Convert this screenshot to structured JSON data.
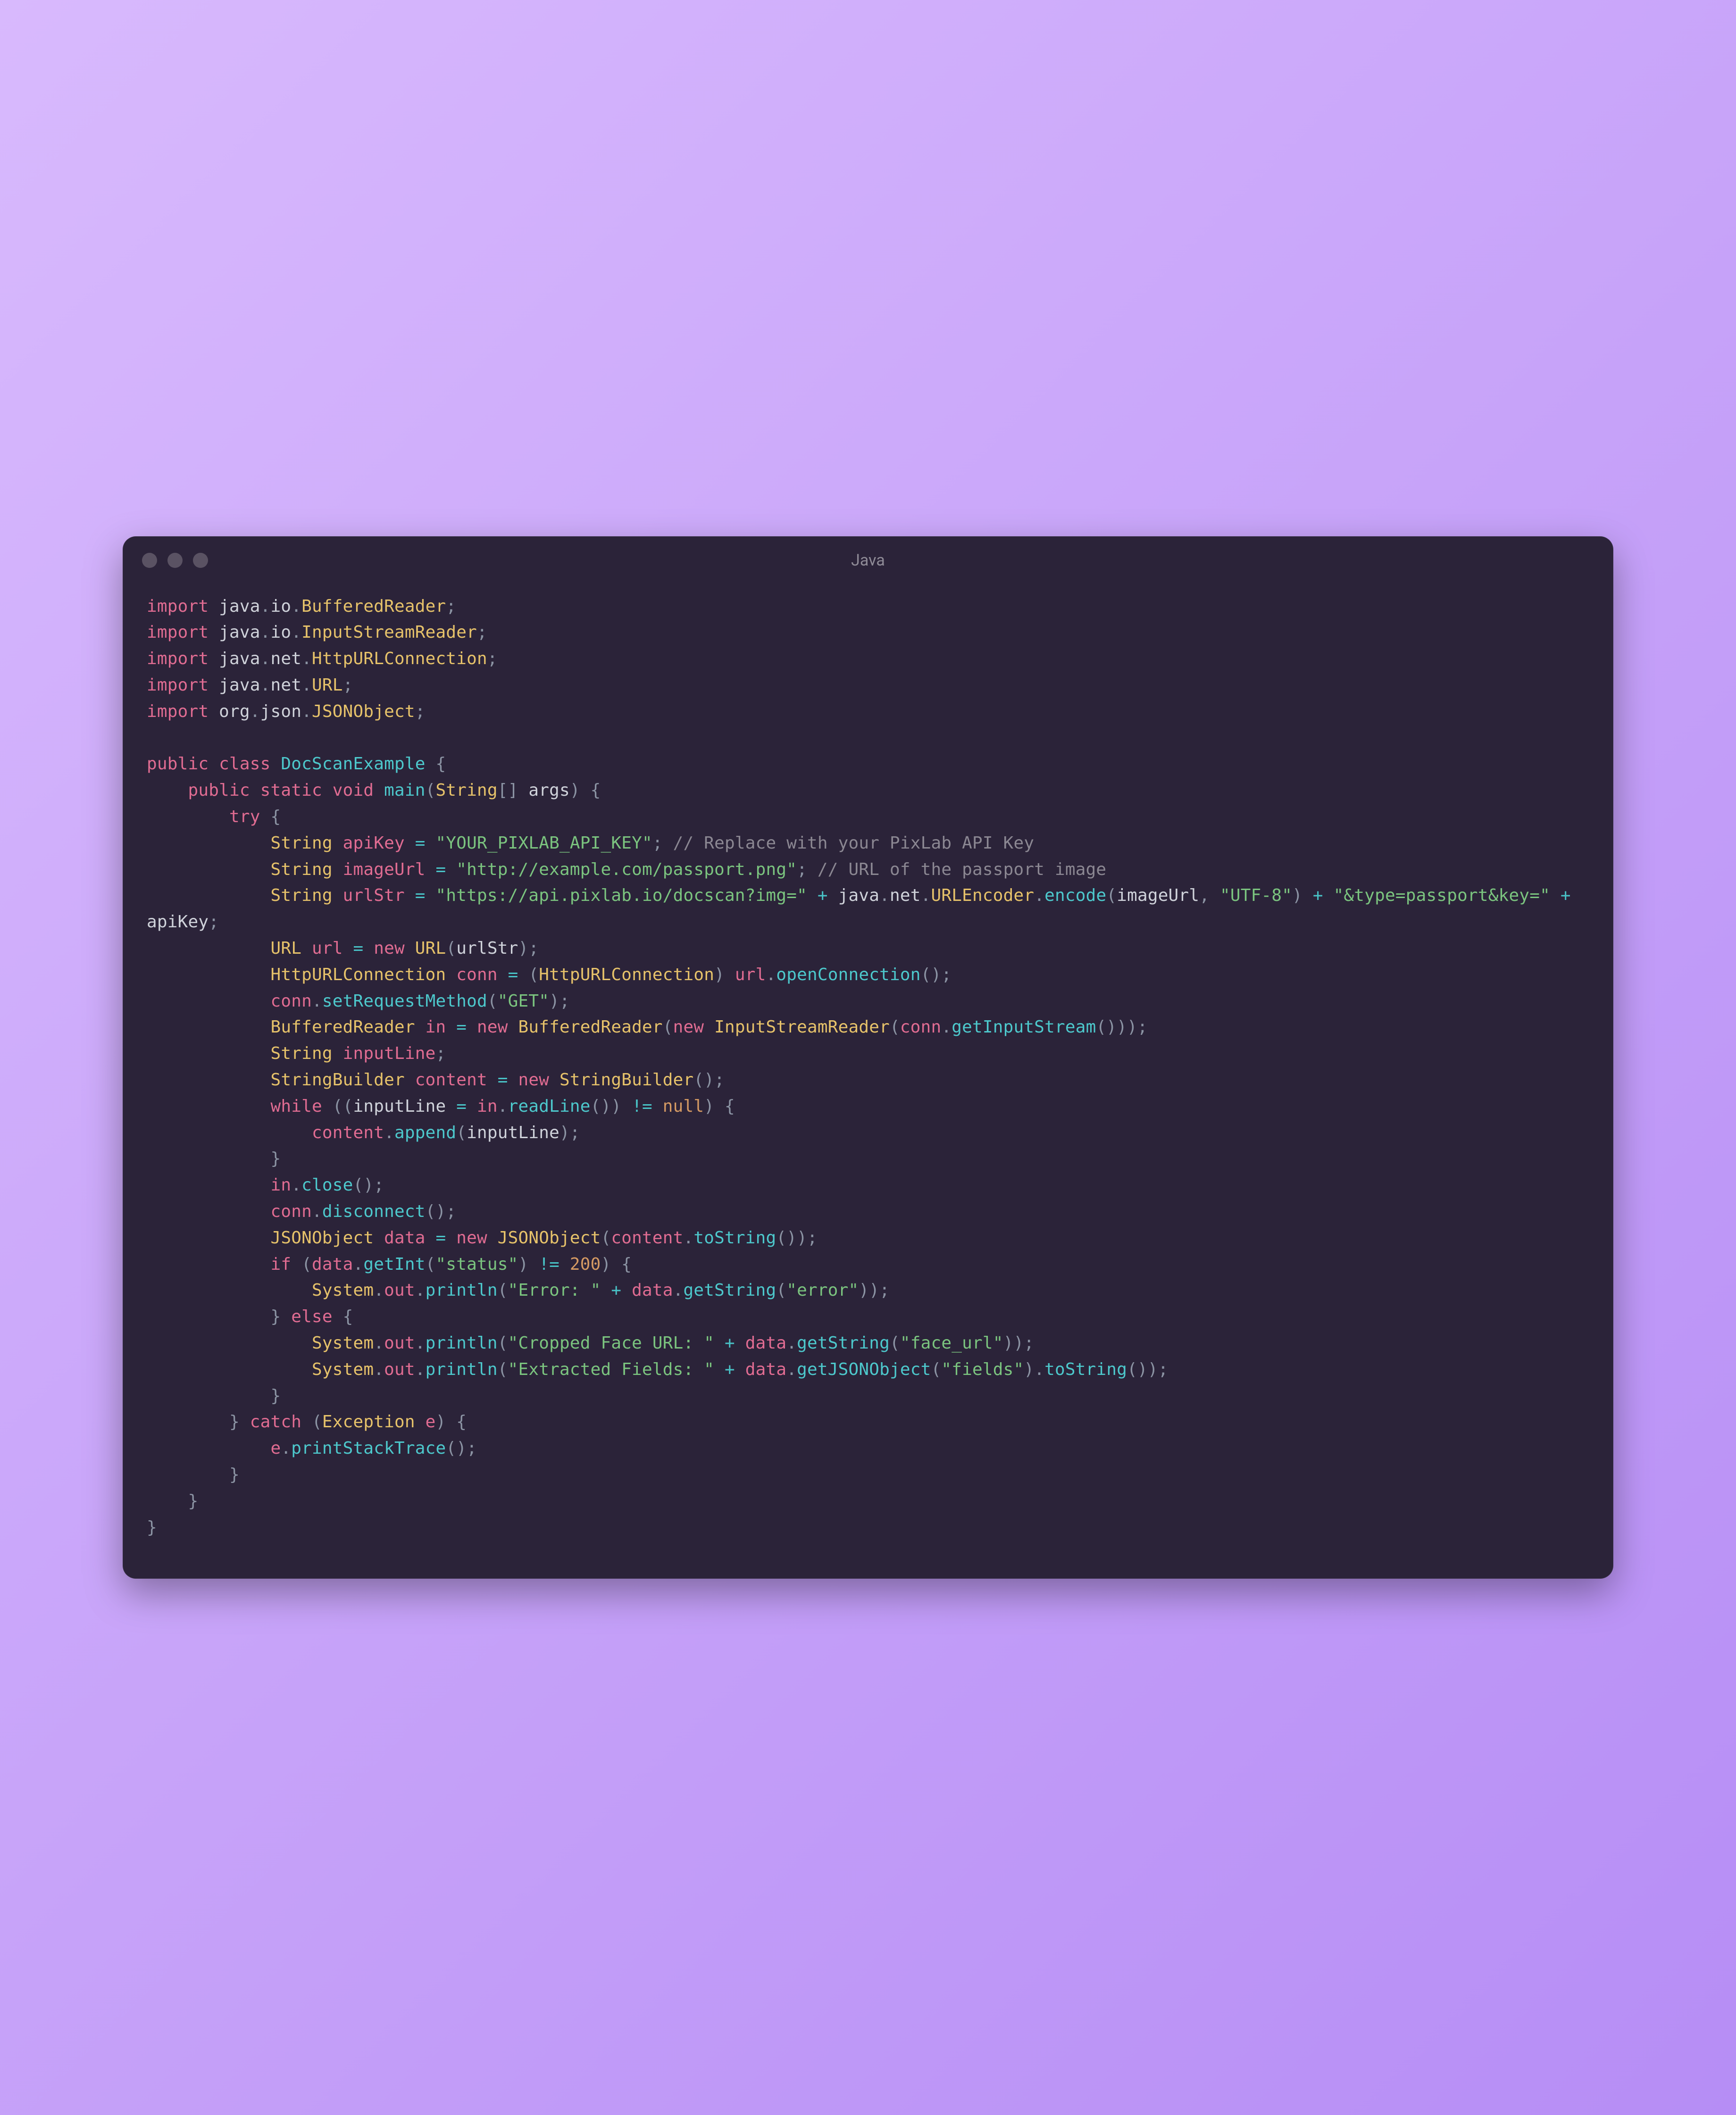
{
  "window": {
    "title": "Java"
  },
  "code": {
    "tokens": [
      [
        [
          "kw",
          "import"
        ],
        [
          "pun",
          " "
        ],
        [
          "id",
          "java"
        ],
        [
          "pun",
          "."
        ],
        [
          "id",
          "io"
        ],
        [
          "pun",
          "."
        ],
        [
          "type",
          "BufferedReader"
        ],
        [
          "pun",
          ";"
        ]
      ],
      [
        [
          "kw",
          "import"
        ],
        [
          "pun",
          " "
        ],
        [
          "id",
          "java"
        ],
        [
          "pun",
          "."
        ],
        [
          "id",
          "io"
        ],
        [
          "pun",
          "."
        ],
        [
          "type",
          "InputStreamReader"
        ],
        [
          "pun",
          ";"
        ]
      ],
      [
        [
          "kw",
          "import"
        ],
        [
          "pun",
          " "
        ],
        [
          "id",
          "java"
        ],
        [
          "pun",
          "."
        ],
        [
          "id",
          "net"
        ],
        [
          "pun",
          "."
        ],
        [
          "type",
          "HttpURLConnection"
        ],
        [
          "pun",
          ";"
        ]
      ],
      [
        [
          "kw",
          "import"
        ],
        [
          "pun",
          " "
        ],
        [
          "id",
          "java"
        ],
        [
          "pun",
          "."
        ],
        [
          "id",
          "net"
        ],
        [
          "pun",
          "."
        ],
        [
          "type",
          "URL"
        ],
        [
          "pun",
          ";"
        ]
      ],
      [
        [
          "kw",
          "import"
        ],
        [
          "pun",
          " "
        ],
        [
          "id",
          "org"
        ],
        [
          "pun",
          "."
        ],
        [
          "id",
          "json"
        ],
        [
          "pun",
          "."
        ],
        [
          "type",
          "JSONObject"
        ],
        [
          "pun",
          ";"
        ]
      ],
      [],
      [
        [
          "kw",
          "public"
        ],
        [
          "pun",
          " "
        ],
        [
          "kw",
          "class"
        ],
        [
          "pun",
          " "
        ],
        [
          "fn",
          "DocScanExample"
        ],
        [
          "pun",
          " {"
        ]
      ],
      [
        [
          "pun",
          "    "
        ],
        [
          "kw",
          "public"
        ],
        [
          "pun",
          " "
        ],
        [
          "kw",
          "static"
        ],
        [
          "pun",
          " "
        ],
        [
          "kw",
          "void"
        ],
        [
          "pun",
          " "
        ],
        [
          "fn",
          "main"
        ],
        [
          "pun",
          "("
        ],
        [
          "type",
          "String"
        ],
        [
          "pun",
          "[] "
        ],
        [
          "id",
          "args"
        ],
        [
          "pun",
          ") {"
        ]
      ],
      [
        [
          "pun",
          "        "
        ],
        [
          "kw",
          "try"
        ],
        [
          "pun",
          " {"
        ]
      ],
      [
        [
          "pun",
          "            "
        ],
        [
          "type",
          "String"
        ],
        [
          "pun",
          " "
        ],
        [
          "var",
          "apiKey"
        ],
        [
          "pun",
          " "
        ],
        [
          "op",
          "="
        ],
        [
          "pun",
          " "
        ],
        [
          "str",
          "\"YOUR_PIXLAB_API_KEY\""
        ],
        [
          "pun",
          "; "
        ],
        [
          "cmt",
          "// Replace with your PixLab API Key"
        ]
      ],
      [
        [
          "pun",
          "            "
        ],
        [
          "type",
          "String"
        ],
        [
          "pun",
          " "
        ],
        [
          "var",
          "imageUrl"
        ],
        [
          "pun",
          " "
        ],
        [
          "op",
          "="
        ],
        [
          "pun",
          " "
        ],
        [
          "str",
          "\"http://example.com/passport.png\""
        ],
        [
          "pun",
          "; "
        ],
        [
          "cmt",
          "// URL of the passport image"
        ]
      ],
      [
        [
          "pun",
          "            "
        ],
        [
          "type",
          "String"
        ],
        [
          "pun",
          " "
        ],
        [
          "var",
          "urlStr"
        ],
        [
          "pun",
          " "
        ],
        [
          "op",
          "="
        ],
        [
          "pun",
          " "
        ],
        [
          "str",
          "\"https://api.pixlab.io/docscan?img=\""
        ],
        [
          "pun",
          " "
        ],
        [
          "op",
          "+"
        ],
        [
          "pun",
          " "
        ],
        [
          "id",
          "java"
        ],
        [
          "pun",
          "."
        ],
        [
          "id",
          "net"
        ],
        [
          "pun",
          "."
        ],
        [
          "type",
          "URLEncoder"
        ],
        [
          "pun",
          "."
        ],
        [
          "fn",
          "encode"
        ],
        [
          "pun",
          "("
        ],
        [
          "id",
          "imageUrl"
        ],
        [
          "pun",
          ", "
        ],
        [
          "str",
          "\"UTF-8\""
        ],
        [
          "pun",
          ") "
        ],
        [
          "op",
          "+"
        ],
        [
          "pun",
          " "
        ],
        [
          "str",
          "\"&type=passport&key=\""
        ],
        [
          "pun",
          " "
        ],
        [
          "op",
          "+"
        ],
        [
          "pun",
          " "
        ],
        [
          "id",
          "apiKey"
        ],
        [
          "pun",
          ";"
        ]
      ],
      [
        [
          "pun",
          "            "
        ],
        [
          "type",
          "URL"
        ],
        [
          "pun",
          " "
        ],
        [
          "var",
          "url"
        ],
        [
          "pun",
          " "
        ],
        [
          "op",
          "="
        ],
        [
          "pun",
          " "
        ],
        [
          "kw",
          "new"
        ],
        [
          "pun",
          " "
        ],
        [
          "type",
          "URL"
        ],
        [
          "pun",
          "("
        ],
        [
          "id",
          "urlStr"
        ],
        [
          "pun",
          ");"
        ]
      ],
      [
        [
          "pun",
          "            "
        ],
        [
          "type",
          "HttpURLConnection"
        ],
        [
          "pun",
          " "
        ],
        [
          "var",
          "conn"
        ],
        [
          "pun",
          " "
        ],
        [
          "op",
          "="
        ],
        [
          "pun",
          " ("
        ],
        [
          "type",
          "HttpURLConnection"
        ],
        [
          "pun",
          ") "
        ],
        [
          "var",
          "url"
        ],
        [
          "pun",
          "."
        ],
        [
          "fn",
          "openConnection"
        ],
        [
          "pun",
          "();"
        ]
      ],
      [
        [
          "pun",
          "            "
        ],
        [
          "var",
          "conn"
        ],
        [
          "pun",
          "."
        ],
        [
          "fn",
          "setRequestMethod"
        ],
        [
          "pun",
          "("
        ],
        [
          "str",
          "\"GET\""
        ],
        [
          "pun",
          ");"
        ]
      ],
      [
        [
          "pun",
          "            "
        ],
        [
          "type",
          "BufferedReader"
        ],
        [
          "pun",
          " "
        ],
        [
          "var",
          "in"
        ],
        [
          "pun",
          " "
        ],
        [
          "op",
          "="
        ],
        [
          "pun",
          " "
        ],
        [
          "kw",
          "new"
        ],
        [
          "pun",
          " "
        ],
        [
          "type",
          "BufferedReader"
        ],
        [
          "pun",
          "("
        ],
        [
          "kw",
          "new"
        ],
        [
          "pun",
          " "
        ],
        [
          "type",
          "InputStreamReader"
        ],
        [
          "pun",
          "("
        ],
        [
          "var",
          "conn"
        ],
        [
          "pun",
          "."
        ],
        [
          "fn",
          "getInputStream"
        ],
        [
          "pun",
          "()));"
        ]
      ],
      [
        [
          "pun",
          "            "
        ],
        [
          "type",
          "String"
        ],
        [
          "pun",
          " "
        ],
        [
          "var",
          "inputLine"
        ],
        [
          "pun",
          ";"
        ]
      ],
      [
        [
          "pun",
          "            "
        ],
        [
          "type",
          "StringBuilder"
        ],
        [
          "pun",
          " "
        ],
        [
          "var",
          "content"
        ],
        [
          "pun",
          " "
        ],
        [
          "op",
          "="
        ],
        [
          "pun",
          " "
        ],
        [
          "kw",
          "new"
        ],
        [
          "pun",
          " "
        ],
        [
          "type",
          "StringBuilder"
        ],
        [
          "pun",
          "();"
        ]
      ],
      [
        [
          "pun",
          "            "
        ],
        [
          "kw",
          "while"
        ],
        [
          "pun",
          " (("
        ],
        [
          "id",
          "inputLine"
        ],
        [
          "pun",
          " "
        ],
        [
          "op",
          "="
        ],
        [
          "pun",
          " "
        ],
        [
          "var",
          "in"
        ],
        [
          "pun",
          "."
        ],
        [
          "fn",
          "readLine"
        ],
        [
          "pun",
          "()) "
        ],
        [
          "op",
          "!="
        ],
        [
          "pun",
          " "
        ],
        [
          "null",
          "null"
        ],
        [
          "pun",
          ") {"
        ]
      ],
      [
        [
          "pun",
          "                "
        ],
        [
          "var",
          "content"
        ],
        [
          "pun",
          "."
        ],
        [
          "fn",
          "append"
        ],
        [
          "pun",
          "("
        ],
        [
          "id",
          "inputLine"
        ],
        [
          "pun",
          ");"
        ]
      ],
      [
        [
          "pun",
          "            }"
        ]
      ],
      [
        [
          "pun",
          "            "
        ],
        [
          "var",
          "in"
        ],
        [
          "pun",
          "."
        ],
        [
          "fn",
          "close"
        ],
        [
          "pun",
          "();"
        ]
      ],
      [
        [
          "pun",
          "            "
        ],
        [
          "var",
          "conn"
        ],
        [
          "pun",
          "."
        ],
        [
          "fn",
          "disconnect"
        ],
        [
          "pun",
          "();"
        ]
      ],
      [
        [
          "pun",
          "            "
        ],
        [
          "type",
          "JSONObject"
        ],
        [
          "pun",
          " "
        ],
        [
          "var",
          "data"
        ],
        [
          "pun",
          " "
        ],
        [
          "op",
          "="
        ],
        [
          "pun",
          " "
        ],
        [
          "kw",
          "new"
        ],
        [
          "pun",
          " "
        ],
        [
          "type",
          "JSONObject"
        ],
        [
          "pun",
          "("
        ],
        [
          "var",
          "content"
        ],
        [
          "pun",
          "."
        ],
        [
          "fn",
          "toString"
        ],
        [
          "pun",
          "());"
        ]
      ],
      [
        [
          "pun",
          "            "
        ],
        [
          "kw",
          "if"
        ],
        [
          "pun",
          " ("
        ],
        [
          "var",
          "data"
        ],
        [
          "pun",
          "."
        ],
        [
          "fn",
          "getInt"
        ],
        [
          "pun",
          "("
        ],
        [
          "str",
          "\"status\""
        ],
        [
          "pun",
          ") "
        ],
        [
          "op",
          "!="
        ],
        [
          "pun",
          " "
        ],
        [
          "num",
          "200"
        ],
        [
          "pun",
          ") {"
        ]
      ],
      [
        [
          "pun",
          "                "
        ],
        [
          "type",
          "System"
        ],
        [
          "pun",
          "."
        ],
        [
          "var",
          "out"
        ],
        [
          "pun",
          "."
        ],
        [
          "fn",
          "println"
        ],
        [
          "pun",
          "("
        ],
        [
          "str",
          "\"Error: \""
        ],
        [
          "pun",
          " "
        ],
        [
          "op",
          "+"
        ],
        [
          "pun",
          " "
        ],
        [
          "var",
          "data"
        ],
        [
          "pun",
          "."
        ],
        [
          "fn",
          "getString"
        ],
        [
          "pun",
          "("
        ],
        [
          "str",
          "\"error\""
        ],
        [
          "pun",
          "));"
        ]
      ],
      [
        [
          "pun",
          "            } "
        ],
        [
          "kw",
          "else"
        ],
        [
          "pun",
          " {"
        ]
      ],
      [
        [
          "pun",
          "                "
        ],
        [
          "type",
          "System"
        ],
        [
          "pun",
          "."
        ],
        [
          "var",
          "out"
        ],
        [
          "pun",
          "."
        ],
        [
          "fn",
          "println"
        ],
        [
          "pun",
          "("
        ],
        [
          "str",
          "\"Cropped Face URL: \""
        ],
        [
          "pun",
          " "
        ],
        [
          "op",
          "+"
        ],
        [
          "pun",
          " "
        ],
        [
          "var",
          "data"
        ],
        [
          "pun",
          "."
        ],
        [
          "fn",
          "getString"
        ],
        [
          "pun",
          "("
        ],
        [
          "str",
          "\"face_url\""
        ],
        [
          "pun",
          "));"
        ]
      ],
      [
        [
          "pun",
          "                "
        ],
        [
          "type",
          "System"
        ],
        [
          "pun",
          "."
        ],
        [
          "var",
          "out"
        ],
        [
          "pun",
          "."
        ],
        [
          "fn",
          "println"
        ],
        [
          "pun",
          "("
        ],
        [
          "str",
          "\"Extracted Fields: \""
        ],
        [
          "pun",
          " "
        ],
        [
          "op",
          "+"
        ],
        [
          "pun",
          " "
        ],
        [
          "var",
          "data"
        ],
        [
          "pun",
          "."
        ],
        [
          "fn",
          "getJSONObject"
        ],
        [
          "pun",
          "("
        ],
        [
          "str",
          "\"fields\""
        ],
        [
          "pun",
          ")."
        ],
        [
          "fn",
          "toString"
        ],
        [
          "pun",
          "());"
        ]
      ],
      [
        [
          "pun",
          "            }"
        ]
      ],
      [
        [
          "pun",
          "        } "
        ],
        [
          "kw",
          "catch"
        ],
        [
          "pun",
          " ("
        ],
        [
          "type",
          "Exception"
        ],
        [
          "pun",
          " "
        ],
        [
          "var",
          "e"
        ],
        [
          "pun",
          ") {"
        ]
      ],
      [
        [
          "pun",
          "            "
        ],
        [
          "var",
          "e"
        ],
        [
          "pun",
          "."
        ],
        [
          "fn",
          "printStackTrace"
        ],
        [
          "pun",
          "();"
        ]
      ],
      [
        [
          "pun",
          "        }"
        ]
      ],
      [
        [
          "pun",
          "    }"
        ]
      ],
      [
        [
          "pun",
          "}"
        ]
      ]
    ]
  }
}
